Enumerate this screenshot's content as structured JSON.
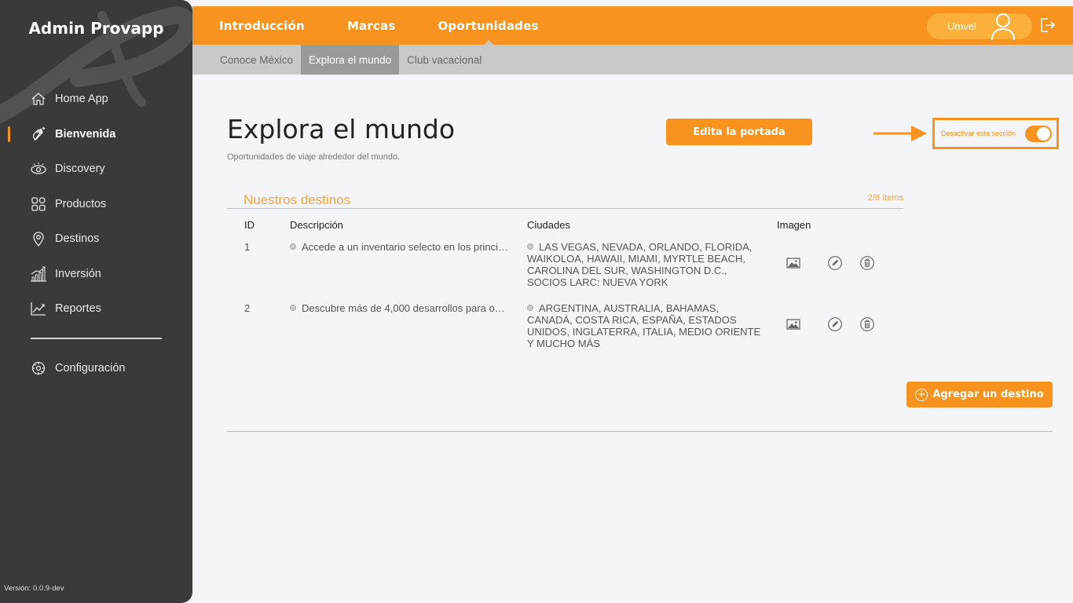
{
  "app": {
    "title": "Admin Provapp",
    "version": "Versión: 0.0.9-dev"
  },
  "sidebar": {
    "items": [
      {
        "label": "Home App",
        "icon": "home-icon"
      },
      {
        "label": "Bienvenida",
        "icon": "wave-hand-icon",
        "active": true
      },
      {
        "label": "Discovery",
        "icon": "eye-icon"
      },
      {
        "label": "Productos",
        "icon": "grid-icon"
      },
      {
        "label": "Destinos",
        "icon": "location-pin-icon"
      },
      {
        "label": "Inversión",
        "icon": "bar-chart-icon"
      },
      {
        "label": "Reportes",
        "icon": "line-chart-icon"
      }
    ],
    "config": {
      "label": "Configuración",
      "icon": "gear-icon"
    }
  },
  "topnav": {
    "tabs": [
      "Introducción",
      "Marcas",
      "Oportunidades"
    ],
    "active": "Oportunidades",
    "user": "Umvel"
  },
  "subnav": {
    "tabs": [
      "Conoce México",
      "Explora el mundo",
      "Club vacacional"
    ],
    "active": "Explora el mundo"
  },
  "main": {
    "title": "Explora el mundo",
    "subtitle": "Oportunidades de viaje alrededor del mundo.",
    "cover_button": "Edita la portada",
    "toggle_label": "Desactivar esta sección",
    "toggle_on": true,
    "section_title": "Nuestros destinos",
    "section_count": "2/6 ítems",
    "table": {
      "headers": [
        "ID",
        "Descripción",
        "Ciudades",
        "Imagen"
      ],
      "rows": [
        {
          "id": "1",
          "description": "Accede a un inventario selecto en los princi…",
          "cities": "LAS VEGAS, NEVADA, ORLANDO, FLORIDA, WAIKOLOA, HAWAII, MIAMI, MYRTLE BEACH, CAROLINA DEL SUR, WASHINGTON D.C., SOCIOS LARC: NUEVA YORK"
        },
        {
          "id": "2",
          "description": "Descubre más de 4,000 desarrollos para op…",
          "cities": "ARGENTINA, AUSTRALIA, BAHAMAS, CANADÁ, COSTA RICA, ESPAÑA, ESTADOS UNIDOS, INGLATERRA, ITALIA, MEDIO ORIENTE Y MUCHO MÁS"
        }
      ]
    },
    "add_button": "Agregar un destino"
  },
  "colors": {
    "accent": "#f7931e",
    "sidebar": "#3a3a3a",
    "subnav": "#c9c9c9"
  }
}
